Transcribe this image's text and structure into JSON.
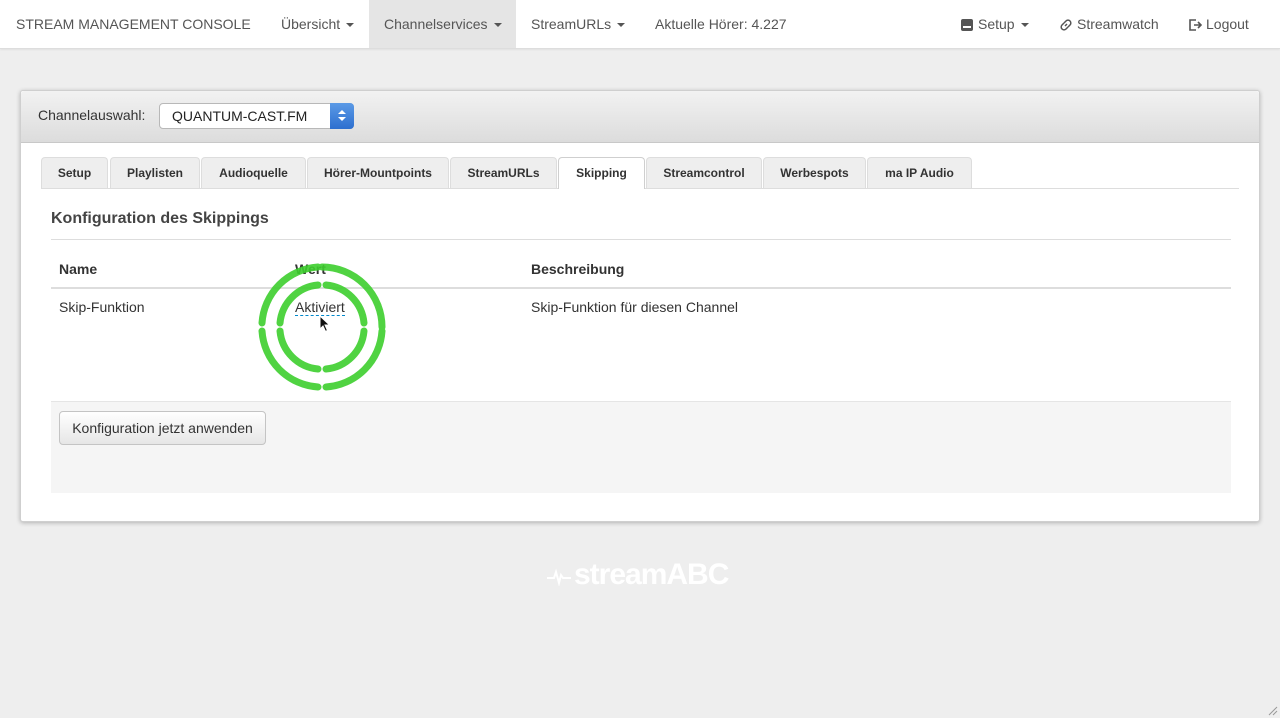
{
  "navbar": {
    "brand": "STREAM MANAGEMENT CONSOLE",
    "items": [
      {
        "label": "Übersicht",
        "dropdown": true
      },
      {
        "label": "Channelservices",
        "dropdown": true,
        "active": true
      },
      {
        "label": "StreamURLs",
        "dropdown": true
      }
    ],
    "listeners": "Aktuelle Hörer: 4.227",
    "right": [
      {
        "label": "Setup",
        "icon": "drive-icon",
        "dropdown": true
      },
      {
        "label": "Streamwatch",
        "icon": "link-icon"
      },
      {
        "label": "Logout",
        "icon": "logout-icon"
      }
    ]
  },
  "channel": {
    "label": "Channelauswahl:",
    "selected": "QUANTUM-CAST.FM"
  },
  "tabs": [
    {
      "label": "Setup"
    },
    {
      "label": "Playlisten"
    },
    {
      "label": "Audioquelle"
    },
    {
      "label": "Hörer-Mountpoints"
    },
    {
      "label": "StreamURLs"
    },
    {
      "label": "Skipping",
      "active": true
    },
    {
      "label": "Streamcontrol"
    },
    {
      "label": "Werbespots"
    },
    {
      "label": "ma IP Audio"
    }
  ],
  "section": {
    "title": "Konfiguration des Skippings"
  },
  "table": {
    "headers": [
      "Name",
      "Wert",
      "Beschreibung"
    ],
    "rows": [
      {
        "name": "Skip-Funktion",
        "value": "Aktiviert",
        "description": "Skip-Funktion für diesen Channel"
      }
    ]
  },
  "actions": {
    "apply_label": "Konfiguration jetzt anwenden"
  },
  "footer": {
    "logo": "streamABC"
  },
  "colors": {
    "highlight_ring": "#3ecf2e",
    "select_accent": "#2d6fcf",
    "background": "#eeeeee"
  }
}
